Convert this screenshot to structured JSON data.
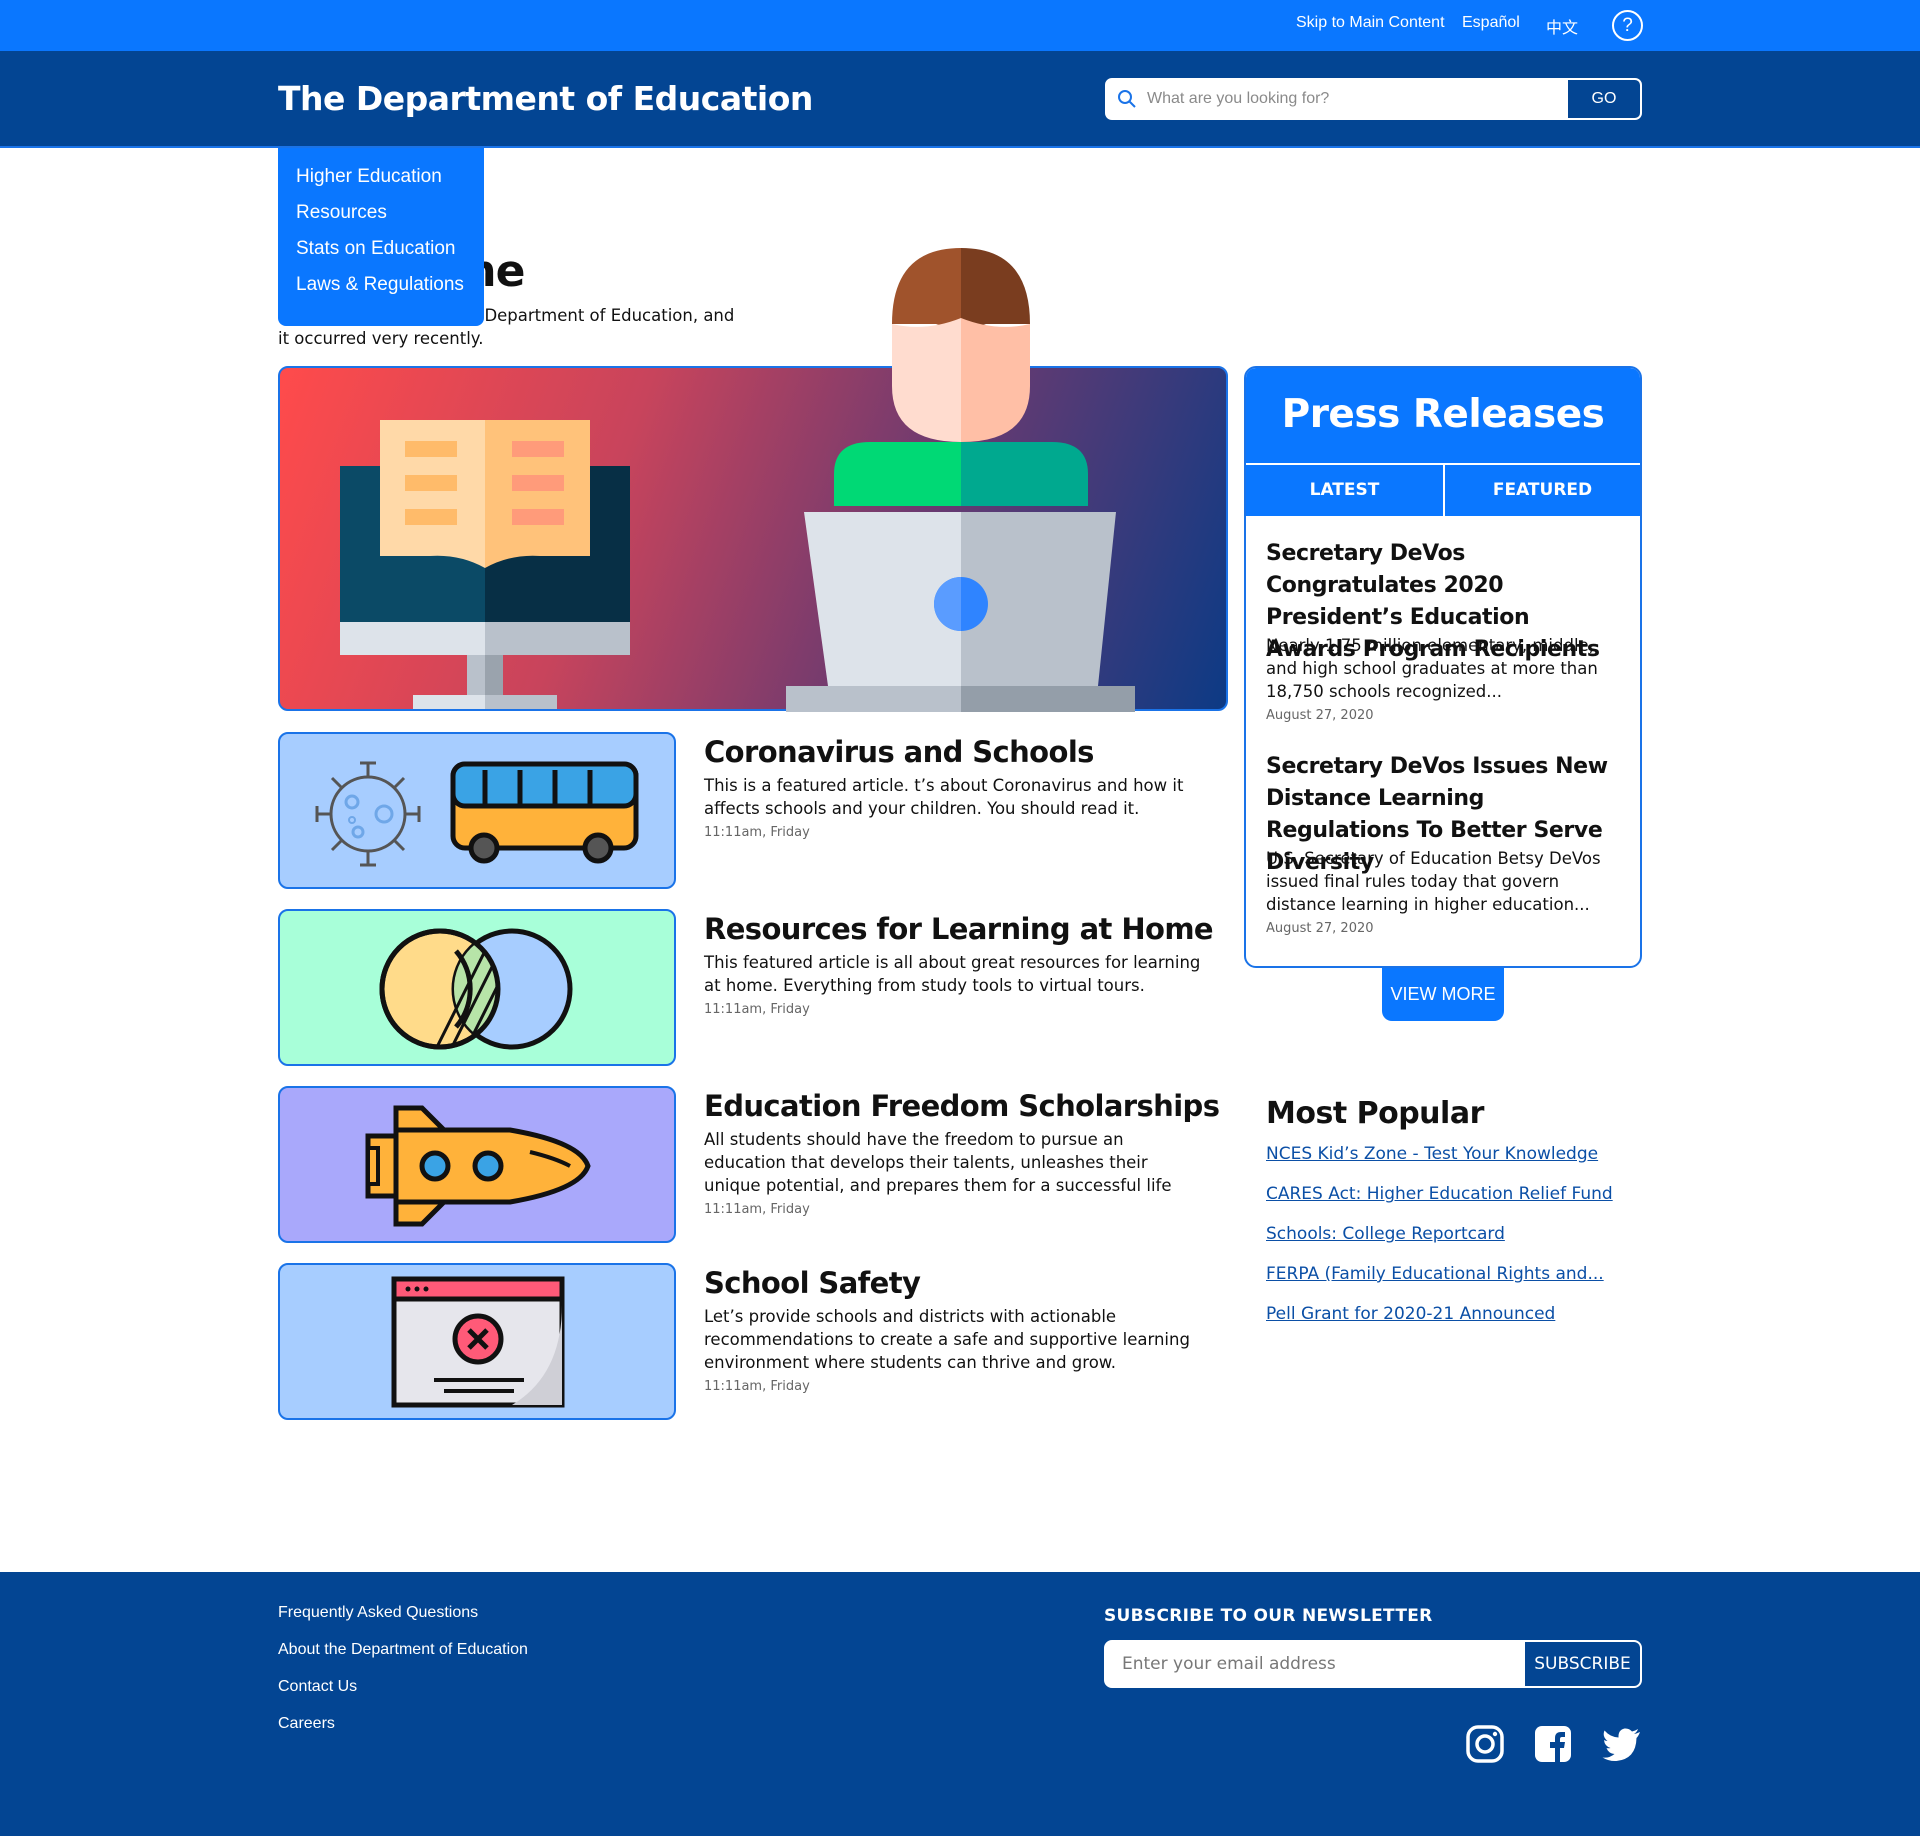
{
  "utility_bar": {
    "skip_link": "Skip to Main Content",
    "lang_es": "Español",
    "lang_zh": "中文",
    "help_glyph": "?"
  },
  "header": {
    "title": "The Department of Education",
    "search_placeholder": "What are you looking for?",
    "go_label": "GO"
  },
  "dropdown": {
    "items": [
      "Higher Education",
      "Resources",
      "Stats on Education",
      "Laws & Regulations"
    ]
  },
  "hero": {
    "title": "n at Home",
    "description": "t piece of news from the Department of Education, and it occurred very recently."
  },
  "articles": [
    {
      "title": "Coronavirus and Schools",
      "text": "This is a featured article. t’s about Coronavirus and how it affects schools and your children. You should read it.",
      "meta": "11:11am, Friday",
      "thumb_color": "#a7cdff"
    },
    {
      "title": "Resources for Learning at Home",
      "text": "This featured article is all about great resources for learning at home. Everything from study tools to virtual tours.",
      "meta": "11:11am, Friday",
      "thumb_color": "#a8ffd9"
    },
    {
      "title": "Education Freedom Scholarships",
      "text": "All students should have the freedom to pursue an education that develops their talents, unleashes their unique potential, and prepares them for a successful life",
      "meta": "11:11am, Friday",
      "thumb_color": "#a9a8fb"
    },
    {
      "title": "School Safety",
      "text": "Let’s provide schools and districts with actionable recommendations to create a safe and supportive learning environment where students can thrive and grow.",
      "meta": "11:11am, Friday",
      "thumb_color": "#a7cdff"
    }
  ],
  "press": {
    "title": "Press Releases",
    "tab_latest": "LATEST",
    "tab_featured": "FEATURED",
    "items": [
      {
        "title": "Secretary DeVos Congratulates 2020 President’s Education Awards Program Recipients",
        "text": "Nearly 1.75 million elementary, middle, and high school graduates at more than 18,750 schools recognized...",
        "date": "August 27, 2020"
      },
      {
        "title": "Secretary DeVos Issues New Distance Learning Regulations To Better Serve Diversity",
        "text": " U.S. Secretary of Education Betsy DeVos issued final rules today that govern distance learning in higher education...",
        "date": "August 27, 2020"
      }
    ],
    "view_more": "VIEW MORE"
  },
  "popular": {
    "title": "Most Popular",
    "links": [
      "NCES Kid’s Zone - Test Your Knowledge",
      "CARES Act: Higher Education Relief Fund",
      "Schools: College Reportcard",
      "FERPA (Family Educational Rights and...",
      "Pell Grant for 2020-21 Announced"
    ]
  },
  "footer": {
    "links": [
      "Frequently Asked Questions",
      "About the Department of Education",
      "Contact Us",
      "Careers"
    ],
    "newsletter_title": "SUBSCRIBE TO OUR NEWSLETTER",
    "email_placeholder": "Enter your email address",
    "subscribe_label": "SUBSCRIBE",
    "social_icons": [
      "instagram-icon",
      "facebook-icon",
      "twitter-icon"
    ]
  },
  "colors": {
    "utility_bar": "#0a77ff",
    "header": "#034593",
    "accent": "#0a77ff",
    "link": "#0b4fa6"
  }
}
